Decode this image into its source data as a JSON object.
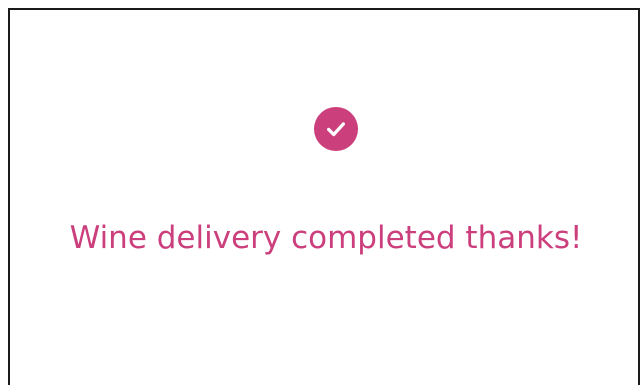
{
  "confirmation": {
    "message": "Wine delivery completed thanks!",
    "icon": "check-circle-icon"
  },
  "colors": {
    "accent": "#cc3f7d",
    "frame_border": "#1a1a1a",
    "background": "#ffffff",
    "icon_glyph": "#ffffff"
  }
}
